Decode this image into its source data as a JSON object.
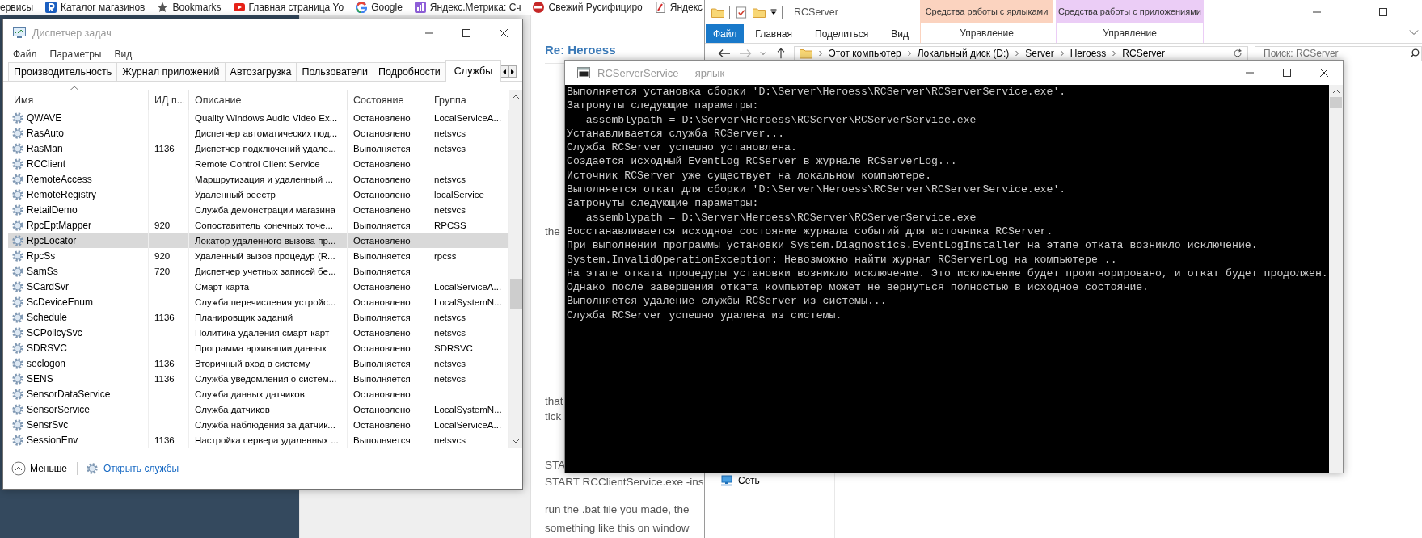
{
  "browser": {
    "bookmarks": [
      {
        "kind": "none",
        "label": "ервисы"
      },
      {
        "kind": "catalog",
        "label": "Каталог магазинов"
      },
      {
        "kind": "star",
        "label": "Bookmarks"
      },
      {
        "kind": "video",
        "label": "Главная страница Yo"
      },
      {
        "kind": "google",
        "label": "Google"
      },
      {
        "kind": "metrics",
        "label": "Яндекс.Метрика: Сч"
      },
      {
        "kind": "redcircle",
        "label": "Свежий Русифициро"
      },
      {
        "kind": "yandex",
        "label": "Яндекс"
      }
    ],
    "page": {
      "title": "Re: Heroess",
      "lines": [
        "the",
        "that",
        "tick",
        "STA",
        "START RCClientService.exe -ins",
        "run the .bat file you made, the",
        "something like this on window"
      ]
    }
  },
  "task_manager": {
    "title": "Диспетчер задач",
    "menu": [
      "Файл",
      "Параметры",
      "Вид"
    ],
    "tabs": [
      {
        "label": "Производительность",
        "selected": false
      },
      {
        "label": "Журнал приложений",
        "selected": false
      },
      {
        "label": "Автозагрузка",
        "selected": false
      },
      {
        "label": "Пользователи",
        "selected": false
      },
      {
        "label": "Подробности",
        "selected": false
      },
      {
        "label": "Службы",
        "selected": true
      }
    ],
    "columns": [
      "Имя",
      "ИД п...",
      "Описание",
      "Состояние",
      "Группа"
    ],
    "rows": [
      {
        "name": "QWAVE",
        "pid": "",
        "description": "Quality Windows Audio Video Ex...",
        "status": "Остановлено",
        "group": "LocalServiceA...",
        "selected": false
      },
      {
        "name": "RasAuto",
        "pid": "",
        "description": "Диспетчер автоматических под...",
        "status": "Остановлено",
        "group": "netsvcs",
        "selected": false
      },
      {
        "name": "RasMan",
        "pid": "1136",
        "description": "Диспетчер подключений удале...",
        "status": "Выполняется",
        "group": "netsvcs",
        "selected": false
      },
      {
        "name": "RCClient",
        "pid": "",
        "description": "Remote Control Client Service",
        "status": "Остановлено",
        "group": "",
        "selected": false
      },
      {
        "name": "RemoteAccess",
        "pid": "",
        "description": "Маршрутизация и удаленный ...",
        "status": "Остановлено",
        "group": "netsvcs",
        "selected": false
      },
      {
        "name": "RemoteRegistry",
        "pid": "",
        "description": "Удаленный реестр",
        "status": "Остановлено",
        "group": "localService",
        "selected": false
      },
      {
        "name": "RetailDemo",
        "pid": "",
        "description": "Служба демонстрации магазина",
        "status": "Остановлено",
        "group": "netsvcs",
        "selected": false
      },
      {
        "name": "RpcEptMapper",
        "pid": "920",
        "description": "Сопоставитель конечных точе...",
        "status": "Выполняется",
        "group": "RPCSS",
        "selected": false
      },
      {
        "name": "RpcLocator",
        "pid": "",
        "description": "Локатор удаленного вызова пр...",
        "status": "Остановлено",
        "group": "",
        "selected": true
      },
      {
        "name": "RpcSs",
        "pid": "920",
        "description": "Удаленный вызов процедур (R...",
        "status": "Выполняется",
        "group": "rpcss",
        "selected": false
      },
      {
        "name": "SamSs",
        "pid": "720",
        "description": "Диспетчер учетных записей бе...",
        "status": "Выполняется",
        "group": "",
        "selected": false
      },
      {
        "name": "SCardSvr",
        "pid": "",
        "description": "Смарт-карта",
        "status": "Остановлено",
        "group": "LocalServiceA...",
        "selected": false
      },
      {
        "name": "ScDeviceEnum",
        "pid": "",
        "description": "Служба перечисления устройс...",
        "status": "Остановлено",
        "group": "LocalSystemN...",
        "selected": false
      },
      {
        "name": "Schedule",
        "pid": "1136",
        "description": "Планировщик заданий",
        "status": "Выполняется",
        "group": "netsvcs",
        "selected": false
      },
      {
        "name": "SCPolicySvc",
        "pid": "",
        "description": "Политика удаления смарт-карт",
        "status": "Остановлено",
        "group": "netsvcs",
        "selected": false
      },
      {
        "name": "SDRSVC",
        "pid": "",
        "description": "Программа архивации данных",
        "status": "Остановлено",
        "group": "SDRSVC",
        "selected": false
      },
      {
        "name": "seclogon",
        "pid": "1136",
        "description": "Вторичный вход в систему",
        "status": "Выполняется",
        "group": "netsvcs",
        "selected": false
      },
      {
        "name": "SENS",
        "pid": "1136",
        "description": "Служба уведомления о систем...",
        "status": "Выполняется",
        "group": "netsvcs",
        "selected": false
      },
      {
        "name": "SensorDataService",
        "pid": "",
        "description": "Служба данных датчиков",
        "status": "Остановлено",
        "group": "",
        "selected": false
      },
      {
        "name": "SensorService",
        "pid": "",
        "description": "Служба датчиков",
        "status": "Остановлено",
        "group": "LocalSystemN...",
        "selected": false
      },
      {
        "name": "SensrSvc",
        "pid": "",
        "description": "Служба наблюдения за датчик...",
        "status": "Остановлено",
        "group": "LocalServiceA...",
        "selected": false
      },
      {
        "name": "SessionEnv",
        "pid": "1136",
        "description": "Настройка сервера удаленных ...",
        "status": "Выполняется",
        "group": "netsvcs",
        "selected": false
      }
    ],
    "footer": {
      "less": "Меньше",
      "open_services": "Открыть службы"
    }
  },
  "explorer": {
    "title": "RCServer",
    "context_tabs": [
      {
        "header": "Средства работы с ярлыками",
        "label": "Управление",
        "color": "#fbd3bf"
      },
      {
        "header": "Средства работы с приложениями",
        "label": "Управление",
        "color": "#ebcdf6"
      }
    ],
    "file_button": "Файл",
    "ribbon_tabs": [
      "Главная",
      "Поделиться",
      "Вид"
    ],
    "address": [
      "Этот компьютер",
      "Локальный диск (D:)",
      "Server",
      "Heroess",
      "RCServer"
    ],
    "search": {
      "placeholder": "Поиск: RCServer"
    },
    "nav_items": [
      "Сеть"
    ]
  },
  "console": {
    "title": "RCServerService — ярлык",
    "lines": [
      "Выполняется установка сборки 'D:\\Server\\Heroess\\RCServer\\RCServerService.exe'.",
      "Затронуты следующие параметры:",
      "   assemblypath = D:\\Server\\Heroess\\RCServer\\RCServerService.exe",
      "Устанавливается служба RCServer...",
      "Служба RCServer успешно установлена.",
      "Создается исходный EventLog RCServer в журнале RCServerLog...",
      "Источник RCServer уже существует на локальном компьютере.",
      "Выполняется откат для сборки 'D:\\Server\\Heroess\\RCServer\\RCServerService.exe'.",
      "Затронуты следующие параметры:",
      "   assemblypath = D:\\Server\\Heroess\\RCServer\\RCServerService.exe",
      "Восстанавливается исходное состояние журнала событий для источника RCServer.",
      "При выполнении программы установки System.Diagnostics.EventLogInstaller на этапе отката возникло исключение.",
      "System.InvalidOperationException: Невозможно найти журнал RCServerLog на компьютере ..",
      "На этапе отката процедуры установки возникло исключение. Это исключение будет проигнорировано, и откат будет продолжен.",
      "Однако после завершения отката компьютер может не вернуться полностью в исходное состояние.",
      "Выполняется удаление службы RCServer из системы...",
      "Служба RCServer успешно удалена из системы."
    ]
  }
}
